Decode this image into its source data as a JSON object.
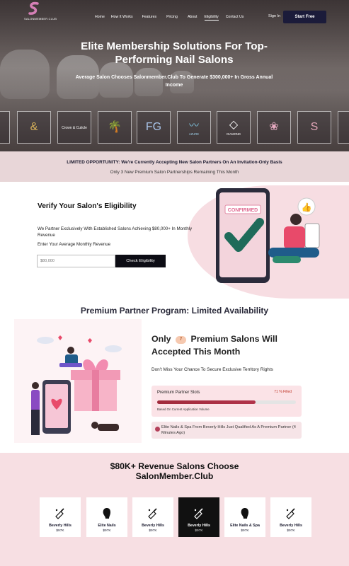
{
  "header": {
    "logo_text": "SALONMEMBER.CLUB",
    "nav": [
      "Home",
      "How It Works",
      "Features",
      "Pricing",
      "About",
      "Eligibility",
      "Contact Us"
    ],
    "active_nav": "Eligibility",
    "signin": "Sign In",
    "cta": "Start Free"
  },
  "hero": {
    "title": "Elite Membership Solutions For Top-Performing Nail Salons",
    "subtitle": "Average Salon Chooses Salonmember.Club To Generate $300,000+ In Gross Annual Income",
    "logos": [
      "&",
      "Crown & Cuticle",
      "palm",
      "FG",
      "AZURE",
      "DIAMOND",
      "lotus",
      "S"
    ]
  },
  "banner": {
    "line1": "LIMITED OPPORTUNITY: We're Currently Accepting New Salon Partners On An Invitation-Only Basis",
    "line2": "Only 3 New Premium Salon Partnerships Remaining This Month"
  },
  "verify": {
    "title": "Verify Your Salon's Eligibility",
    "description": "We Partner Exclusively With Established Salons Achieving $80,000+ In Monthly Revenue",
    "enter_label": "Enter Your Average Monthly Revenue",
    "input_placeholder": "$80,000",
    "button": "Check Eligibility",
    "illustration_label": "CONFIRMED"
  },
  "premium": {
    "title": "Premium Partner Program: Limited Availability",
    "only_prefix": "Only",
    "only_count": "7",
    "only_suffix": "Premium Salons Will Accepted This Month",
    "subtext": "Don't Miss Your Chance To Secure Exclusive Territory Rights",
    "slots_label": "Premium Partner Slots",
    "slots_percent_text": "71 % Filled",
    "slots_fill_fraction": 0.71,
    "slots_note": "Based On Current Application Volume",
    "notification": "Elite Nails & Spa From Beverly Hills Just Qualified As A Premium Partner (4 Minutes Ago)"
  },
  "choose": {
    "title": "$80K+ Revenue Salons Choose SalonMember.Club",
    "cards": [
      {
        "name": "Beverly Hills",
        "revenue": "$97K",
        "icon": "nail-polish-icon",
        "dark": false
      },
      {
        "name": "Elite Nails",
        "revenue": "$97K",
        "icon": "woman-profile-icon",
        "dark": false
      },
      {
        "name": "Beverly Hills",
        "revenue": "$97K",
        "icon": "nail-polish-icon",
        "dark": false
      },
      {
        "name": "Beverly Hills",
        "revenue": "$97K",
        "icon": "nail-polish-icon",
        "dark": true
      },
      {
        "name": "Elite Nails & Spa",
        "revenue": "$97K",
        "icon": "woman-profile-icon",
        "dark": false
      },
      {
        "name": "Beverly Hills",
        "revenue": "$97K",
        "icon": "nail-polish-icon",
        "dark": false
      }
    ]
  },
  "colors": {
    "navy": "#1b1b3a",
    "pink_bg": "#f7dfe3",
    "progress_red": "#a12b3c",
    "accent_orange": "#f6c9b0"
  }
}
